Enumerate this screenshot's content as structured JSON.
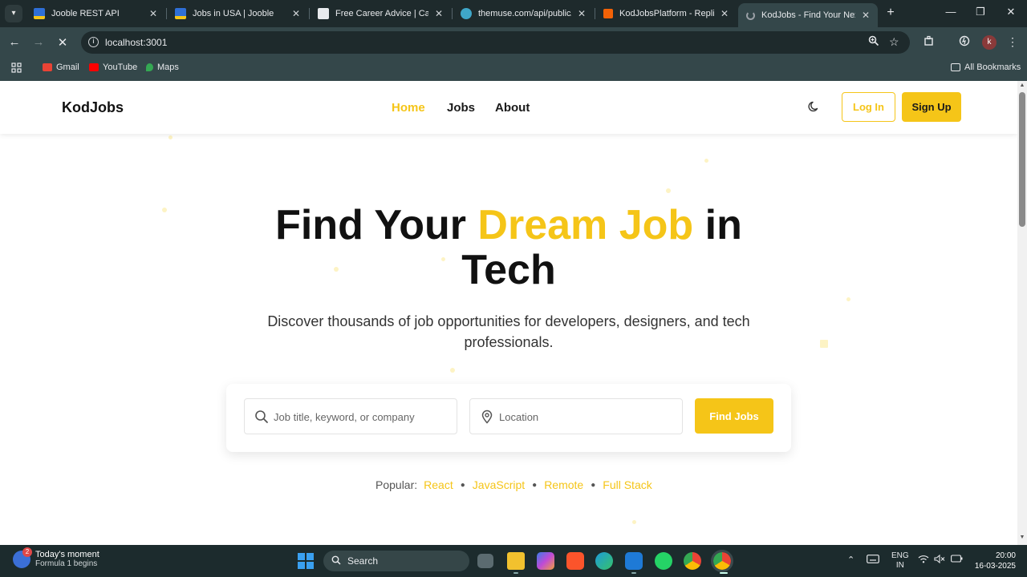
{
  "browser": {
    "tabs": [
      {
        "title": "Jooble REST API",
        "icon": "jooble-favicon",
        "color": "#2f6fd6"
      },
      {
        "title": "Jobs in USA | Jooble",
        "icon": "jooble-favicon",
        "color": "#2f6fd6"
      },
      {
        "title": "Free Career Advice | Career",
        "icon": "document-favicon",
        "color": "#e8eaed"
      },
      {
        "title": "themuse.com/api/public/jo",
        "icon": "themuse-favicon",
        "color": "#3fa7c9"
      },
      {
        "title": "KodJobsPlatform - Replit",
        "icon": "replit-favicon",
        "color": "#f26207"
      },
      {
        "title": "KodJobs - Find Your Next Dr",
        "icon": "loading-favicon",
        "color": "#9aa0a6"
      }
    ],
    "address": "localhost:3001",
    "bookmarks": [
      {
        "label": "Gmail",
        "icon": "gmail-icon",
        "color": "#ea4335"
      },
      {
        "label": "YouTube",
        "icon": "youtube-icon",
        "color": "#ff0000"
      },
      {
        "label": "Maps",
        "icon": "maps-icon",
        "color": "#34a853"
      }
    ],
    "all_bookmarks": "All Bookmarks",
    "profile_initial": "k"
  },
  "site": {
    "logo": "KodJobs",
    "nav": {
      "home": "Home",
      "jobs": "Jobs",
      "about": "About"
    },
    "login": "Log In",
    "signup": "Sign Up",
    "hero": {
      "title_part1": "Find Your ",
      "title_accent": "Dream Job",
      "title_part2": " in Tech",
      "subtitle": "Discover thousands of job opportunities for developers, designers, and tech professionals."
    },
    "search": {
      "keyword_placeholder": "Job title, keyword, or company",
      "location_placeholder": "Location",
      "button": "Find Jobs"
    },
    "popular": {
      "label": "Popular:",
      "tags": [
        "React",
        "JavaScript",
        "Remote",
        "Full Stack"
      ]
    },
    "accent_color": "#f5c518"
  },
  "taskbar": {
    "widget_title": "Today's moment",
    "widget_sub": "Formula 1 begins",
    "widget_badge": "2",
    "search": "Search",
    "lang_top": "ENG",
    "lang_bottom": "IN",
    "time": "20:00",
    "date": "16-03-2025"
  }
}
